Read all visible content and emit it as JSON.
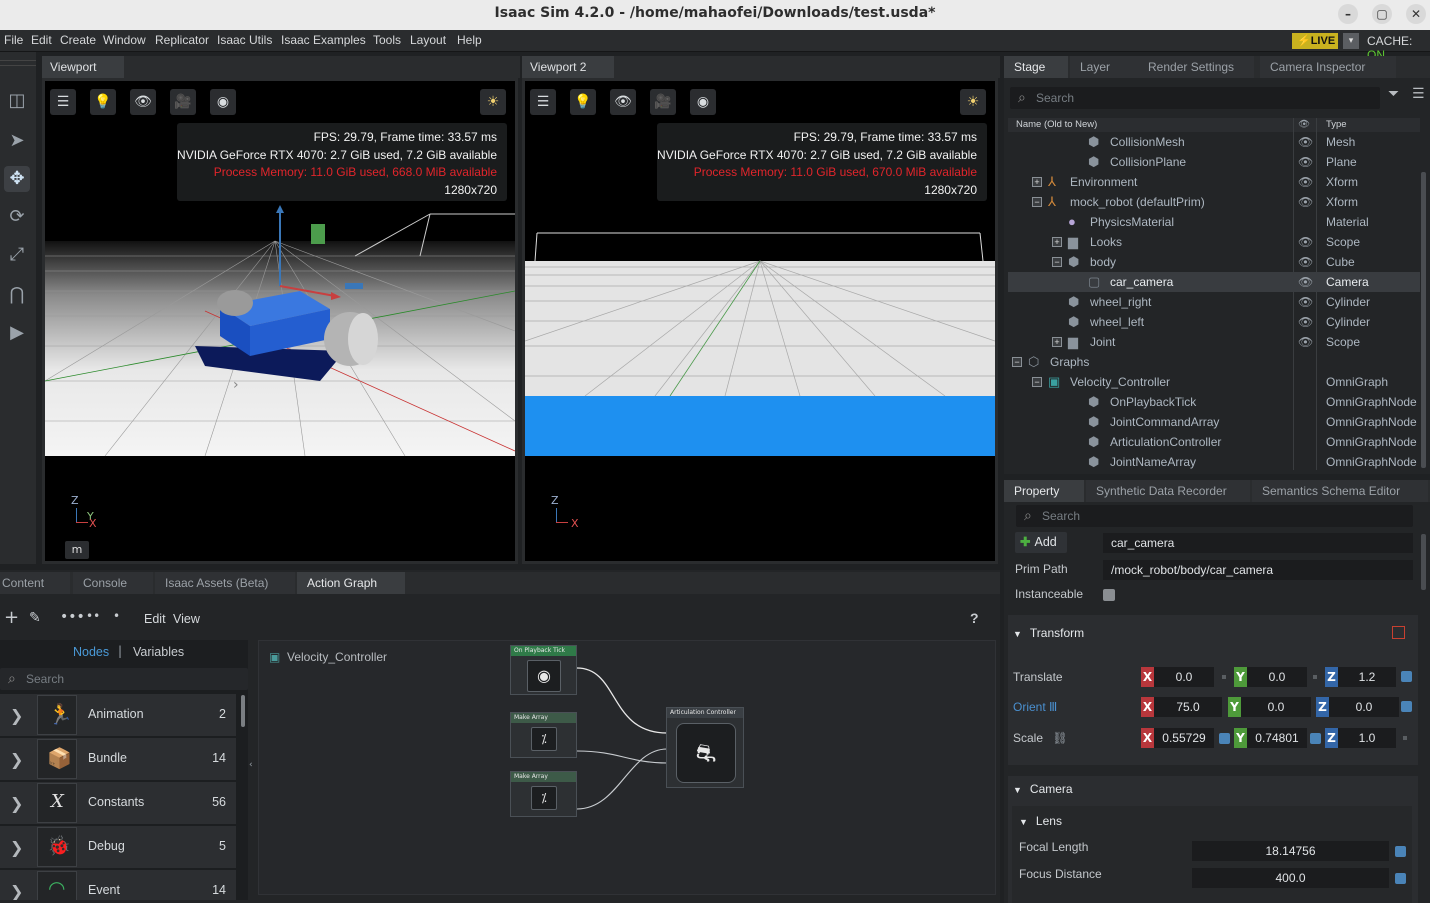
{
  "window": {
    "title": "Isaac Sim 4.2.0 - /home/mahaofei/Downloads/test.usda*",
    "controls": [
      "–",
      "▢",
      "✕"
    ]
  },
  "menu": [
    "File",
    "Edit",
    "Create",
    "Window",
    "Replicator",
    "Isaac Utils",
    "Isaac Examples",
    "Tools",
    "Layout",
    "Help"
  ],
  "status": {
    "live": "LIVE",
    "cache_label": "CACHE:",
    "cache_state": "ON",
    "live_color": "#c9b21f",
    "cache_color": "#5ecb32"
  },
  "viewport1": {
    "tab": "Viewport",
    "fps": "FPS: 29.79, Frame time: 33.57 ms",
    "gpu": "NVIDIA GeForce RTX 4070: 2.7 GiB used, 7.2 GiB available",
    "memory": "Process Memory: 11.0 GiB used, 668.0 MiB available",
    "resolution": "1280x720",
    "unit": "m",
    "axis_z": "Z",
    "axis_y": "Y",
    "axis_x": "X"
  },
  "viewport2": {
    "tab": "Viewport 2",
    "fps": "FPS: 29.79, Frame time: 33.57 ms",
    "gpu": "NVIDIA GeForce RTX 4070: 2.7 GiB used, 7.2 GiB available",
    "memory": "Process Memory: 11.0 GiB used, 670.0 MiB available",
    "resolution": "1280x720",
    "axis_z": "Z",
    "axis_x": "X"
  },
  "stage": {
    "tabs": [
      "Stage",
      "Layer",
      "Render Settings",
      "Camera Inspector"
    ],
    "search_placeholder": "Search",
    "col_name": "Name (Old to New)",
    "col_type": "Type",
    "rows": [
      {
        "name": "CollisionMesh",
        "type": "Mesh",
        "icon": "cube-icon",
        "expander": "",
        "eye": true
      },
      {
        "name": "CollisionPlane",
        "type": "Plane",
        "icon": "cube-icon",
        "expander": "",
        "eye": true
      },
      {
        "name": "Environment",
        "type": "Xform",
        "icon": "xform-icon",
        "expander": "+",
        "eye": true
      },
      {
        "name": "mock_robot (defaultPrim)",
        "type": "Xform",
        "icon": "xform-icon",
        "expander": "-",
        "eye": true
      },
      {
        "name": "PhysicsMaterial",
        "type": "Material",
        "icon": "sphere-icon",
        "expander": "",
        "eye": false
      },
      {
        "name": "Looks",
        "type": "Scope",
        "icon": "folder-icon",
        "expander": "+",
        "eye": true
      },
      {
        "name": "body",
        "type": "Cube",
        "icon": "cube-icon",
        "expander": "-",
        "eye": true
      },
      {
        "name": "car_camera",
        "type": "Camera",
        "icon": "camera-icon",
        "expander": "",
        "eye": true
      },
      {
        "name": "wheel_right",
        "type": "Cylinder",
        "icon": "cube-icon",
        "expander": "",
        "eye": true
      },
      {
        "name": "wheel_left",
        "type": "Cylinder",
        "icon": "cube-icon",
        "expander": "",
        "eye": true
      },
      {
        "name": "Joint",
        "type": "Scope",
        "icon": "folder-icon",
        "expander": "+",
        "eye": true
      },
      {
        "name": "Graphs",
        "type": "",
        "icon": "graph-icon",
        "expander": "-",
        "eye": false
      },
      {
        "name": "Velocity_Controller",
        "type": "OmniGraph",
        "icon": "omnigraph-icon",
        "expander": "-",
        "eye": false
      },
      {
        "name": "OnPlaybackTick",
        "type": "OmniGraphNode",
        "icon": "cube-icon",
        "expander": "",
        "eye": false
      },
      {
        "name": "JointCommandArray",
        "type": "OmniGraphNode",
        "icon": "cube-icon",
        "expander": "",
        "eye": false
      },
      {
        "name": "ArticulationController",
        "type": "OmniGraphNode",
        "icon": "cube-icon",
        "expander": "",
        "eye": false
      },
      {
        "name": "JointNameArray",
        "type": "OmniGraphNode",
        "icon": "cube-icon",
        "expander": "",
        "eye": false
      }
    ]
  },
  "property": {
    "tabs": [
      "Property",
      "Synthetic Data Recorder",
      "Semantics Schema Editor"
    ],
    "search_placeholder": "Search",
    "add_label": "Add",
    "prim_name": "car_camera",
    "prim_path_label": "Prim Path",
    "prim_path": "/mock_robot/body/car_camera",
    "instanceable_label": "Instanceable",
    "transform": {
      "header": "Transform",
      "translate_label": "Translate",
      "translate": {
        "x": "0.0",
        "y": "0.0",
        "z": "1.2"
      },
      "orient_label": "Orient",
      "orient": {
        "x": "75.0",
        "y": "0.0",
        "z": "0.0"
      },
      "scale_label": "Scale",
      "scale": {
        "x": "0.55729",
        "y": "0.74801",
        "z": "1.0"
      }
    },
    "camera": {
      "header": "Camera",
      "lens_header": "Lens",
      "focal_length_label": "Focal Length",
      "focal_length": "18.14756",
      "focus_distance_label": "Focus Distance",
      "focus_distance": "400.0"
    }
  },
  "bottom": {
    "tabs": [
      "Content",
      "Console",
      "Isaac Assets (Beta)",
      "Action Graph"
    ],
    "toolbar": {
      "edit": "Edit",
      "view": "View",
      "help": "?"
    },
    "nodes_label": "Nodes",
    "variables_label": "Variables",
    "search_placeholder": "Search",
    "categories": [
      {
        "name": "Animation",
        "count": "2",
        "icon": "running-icon"
      },
      {
        "name": "Bundle",
        "count": "14",
        "icon": "box-icon"
      },
      {
        "name": "Constants",
        "count": "56",
        "icon": "x-variable-icon"
      },
      {
        "name": "Debug",
        "count": "5",
        "icon": "bug-icon"
      },
      {
        "name": "Event",
        "count": "14",
        "icon": "signal-icon"
      }
    ],
    "graph_name": "Velocity_Controller",
    "graph_nodes": {
      "tick": "On Playback Tick",
      "make1": "Make Array",
      "make2": "Make Array",
      "artic": "Articulation Controller"
    }
  }
}
